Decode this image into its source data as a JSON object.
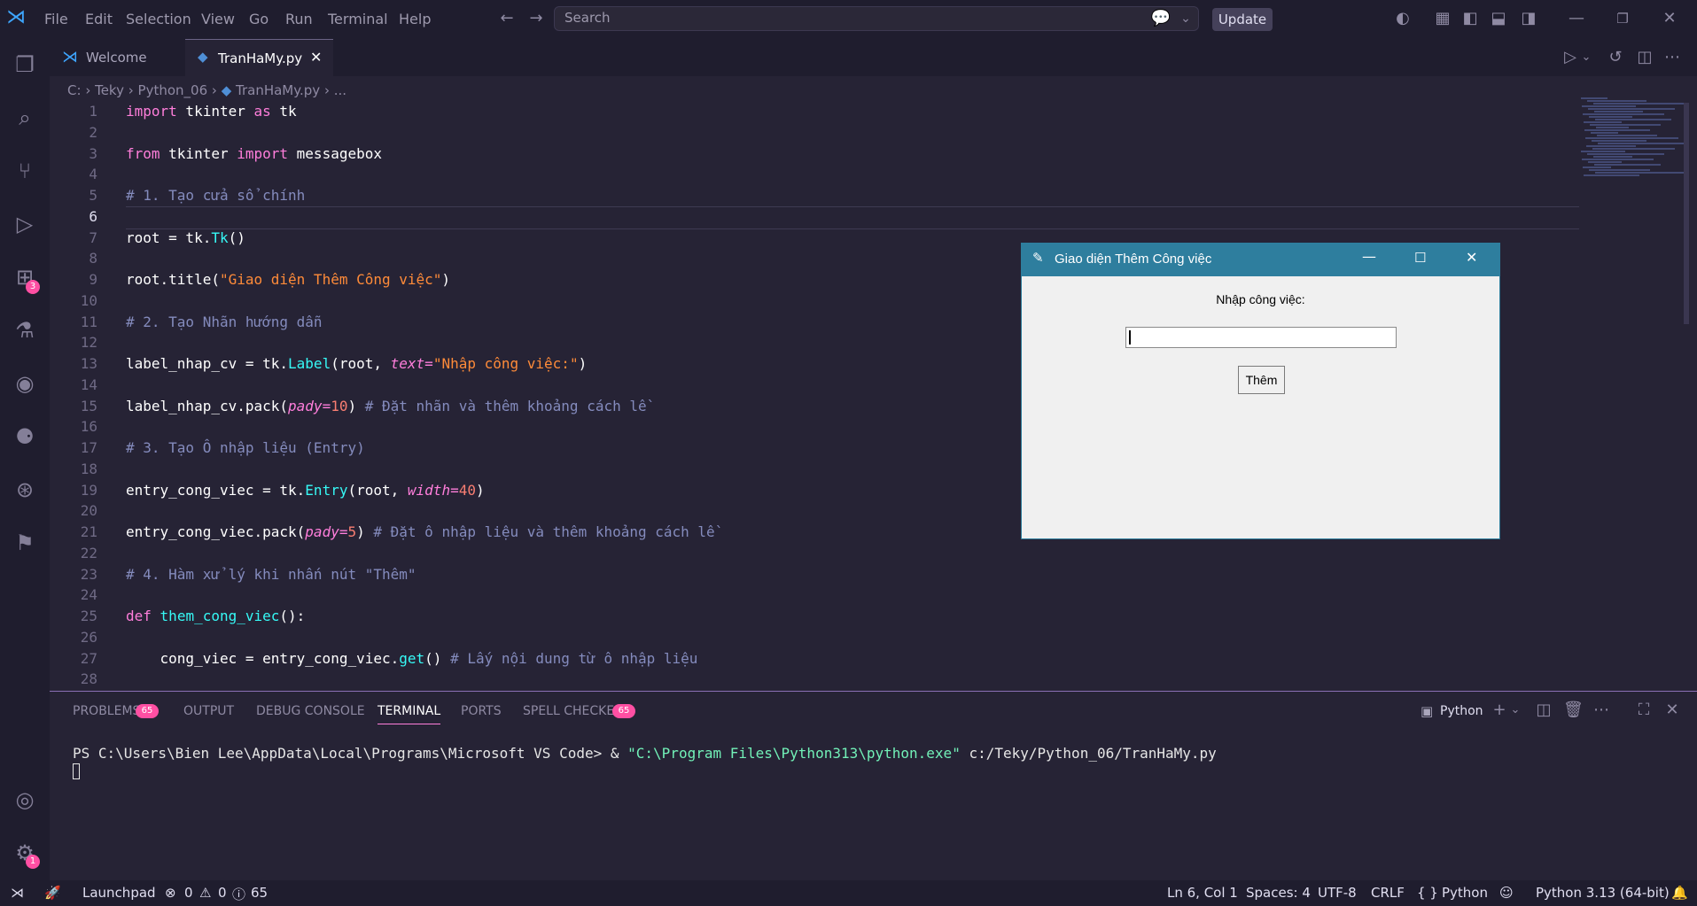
{
  "menu": [
    "File",
    "Edit",
    "Selection",
    "View",
    "Go",
    "Run",
    "Terminal",
    "Help"
  ],
  "search": {
    "placeholder": "Search"
  },
  "update_label": "Update",
  "tabs": [
    {
      "label": "Welcome"
    },
    {
      "label": "TranHaMy.py"
    }
  ],
  "breadcrumb": [
    "C:",
    "Teky",
    "Python_06",
    "TranHaMy.py",
    "..."
  ],
  "activity_badges": {
    "extensions": "3",
    "settings": "1"
  },
  "code": {
    "line_numbers": [
      "1",
      "2",
      "3",
      "4",
      "5",
      "6",
      "7",
      "8",
      "9",
      "10",
      "11",
      "12",
      "13",
      "14",
      "15",
      "16",
      "17",
      "18",
      "19",
      "20",
      "21",
      "22",
      "23",
      "24",
      "25",
      "26",
      "27",
      "28"
    ],
    "l1": {
      "a": "import",
      "b": " tkinter ",
      "c": "as",
      "d": " tk"
    },
    "l3": {
      "a": "from",
      "b": " tkinter ",
      "c": "import",
      "d": " messagebox"
    },
    "l5": "# 1. Tạo cửa sổ chính",
    "l7": {
      "a": "root = tk.",
      "b": "Tk",
      "c": "()"
    },
    "l9": {
      "a": "root.title(",
      "b": "\"Giao diện Thêm Công việc\"",
      "c": ")"
    },
    "l11": "# 2. Tạo Nhãn hướng dẫn",
    "l13": {
      "a": "label_nhap_cv = tk.",
      "b": "Label",
      "c": "(root, ",
      "d": "text",
      "e": "=",
      "f": "\"Nhập công việc:\"",
      "g": ")"
    },
    "l15": {
      "a": "label_nhap_cv.pack(",
      "b": "pady",
      "c": "=",
      "d": "10",
      "e": ") ",
      "f": "# Đặt nhãn và thêm khoảng cách lề"
    },
    "l17": "# 3. Tạo Ô nhập liệu (Entry)",
    "l19": {
      "a": "entry_cong_viec = tk.",
      "b": "Entry",
      "c": "(root, ",
      "d": "width",
      "e": "=",
      "f": "40",
      "g": ")"
    },
    "l21": {
      "a": "entry_cong_viec.pack(",
      "b": "pady",
      "c": "=",
      "d": "5",
      "e": ") ",
      "f": "# Đặt ô nhập liệu và thêm khoảng cách lề"
    },
    "l23": "# 4. Hàm xử lý khi nhấn nút \"Thêm\"",
    "l25": {
      "a": "def",
      "b": " ",
      "c": "them_cong_viec",
      "d": "():"
    },
    "l27": {
      "a": "    cong_viec = entry_cong_viec.",
      "b": "get",
      "c": "() ",
      "d": "# Lấy nội dung từ ô nhập liệu"
    }
  },
  "tk_window": {
    "title": "Giao diện Thêm Công việc",
    "label": "Nhập công việc:",
    "button": "Thêm"
  },
  "panel": {
    "tabs": [
      "PROBLEMS",
      "OUTPUT",
      "DEBUG CONSOLE",
      "TERMINAL",
      "PORTS",
      "SPELL CHECKER"
    ],
    "problems_count": "65",
    "spell_count": "65",
    "terminal_name": "Python",
    "terminal_prompt": "PS C:\\Users\\Bien Lee\\AppData\\Local\\Programs\\Microsoft VS Code> & ",
    "terminal_exe": "\"C:\\Program Files\\Python313\\python.exe\"",
    "terminal_arg": " c:/Teky/Python_06/TranHaMy.py"
  },
  "status": {
    "launchpad": "Launchpad",
    "errors": "0",
    "warnings": "0",
    "infos": "65",
    "position": "Ln 6, Col 1",
    "spaces": "Spaces: 4",
    "encoding": "UTF-8",
    "eol": "CRLF",
    "language": "Python",
    "interpreter": "Python 3.13 (64-bit)"
  }
}
